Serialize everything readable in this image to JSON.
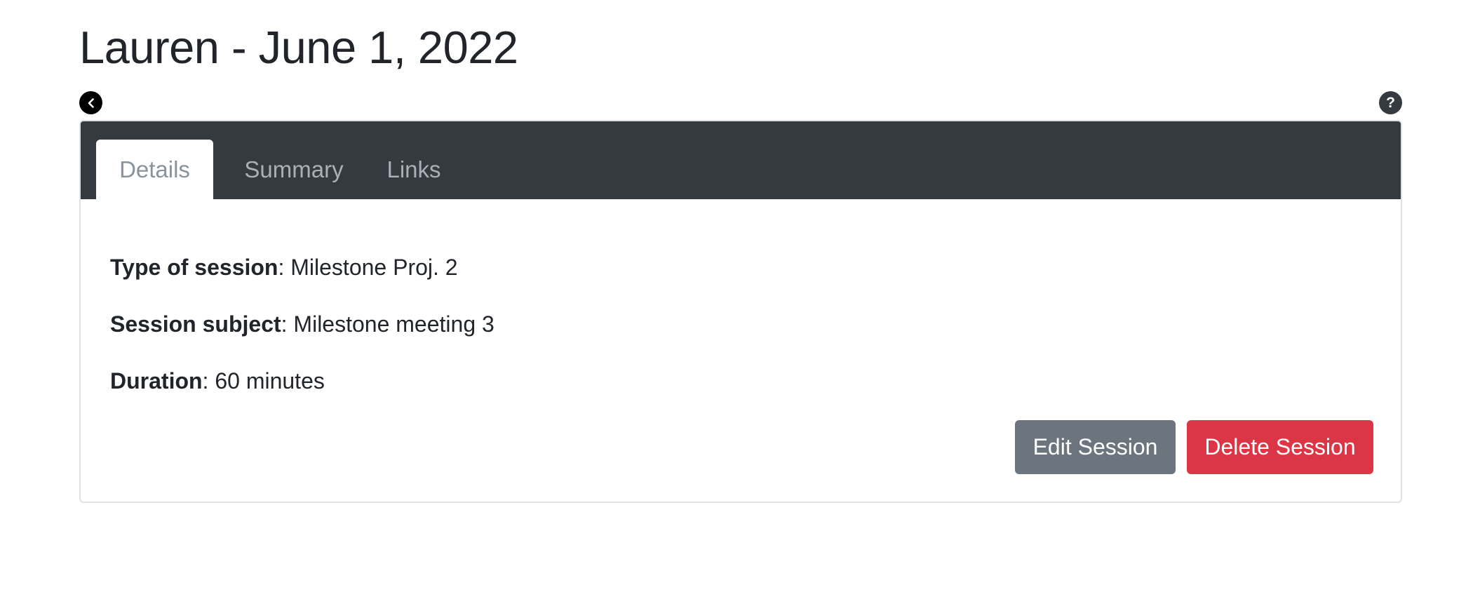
{
  "page": {
    "title": "Lauren - June 1, 2022"
  },
  "controls": {
    "back_icon": "chevron-left-icon",
    "help_icon": "question-mark-icon",
    "help_glyph": "?"
  },
  "tabs": [
    {
      "label": "Details",
      "active": true
    },
    {
      "label": "Summary",
      "active": false
    },
    {
      "label": "Links",
      "active": false
    }
  ],
  "details": [
    {
      "label": "Type of session",
      "value": ": Milestone Proj. 2"
    },
    {
      "label": "Session subject",
      "value": ": Milestone meeting 3"
    },
    {
      "label": "Duration",
      "value": ": 60 minutes"
    }
  ],
  "actions": {
    "edit_label": "Edit Session",
    "delete_label": "Delete Session"
  },
  "colors": {
    "header_bg": "#343a40",
    "edit_button": "#6c757d",
    "delete_button": "#dc3545",
    "text": "#212529"
  }
}
